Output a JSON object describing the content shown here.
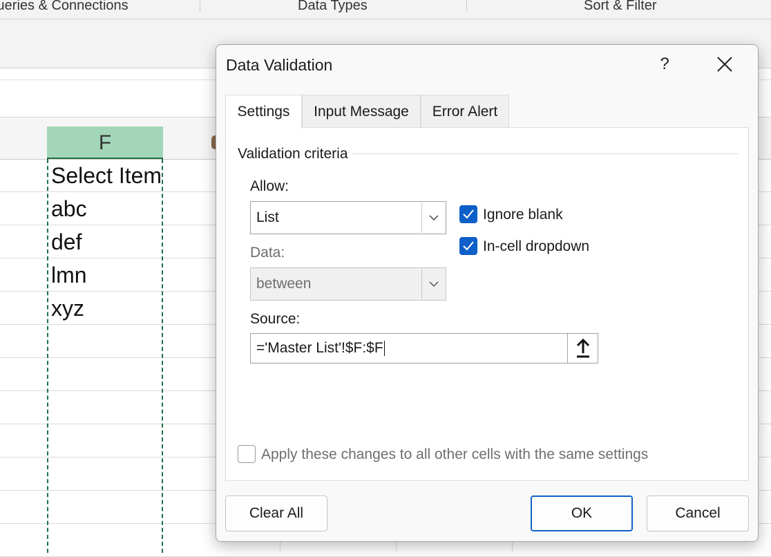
{
  "ribbon": {
    "groups": [
      "Queries & Connections",
      "Data Types",
      "Sort & Filter"
    ]
  },
  "sheet": {
    "selected_column": "F",
    "cells": [
      "Select Item",
      "abc",
      "def",
      "lmn",
      "xyz"
    ]
  },
  "dialog": {
    "title": "Data Validation",
    "help_label": "?",
    "tabs": [
      {
        "label": "Settings",
        "active": true
      },
      {
        "label": "Input Message",
        "active": false
      },
      {
        "label": "Error Alert",
        "active": false
      }
    ],
    "group_label": "Validation criteria",
    "allow": {
      "label": "Allow:",
      "value": "List"
    },
    "data": {
      "label": "Data:",
      "value": "between"
    },
    "source": {
      "label": "Source:",
      "value": "='Master List'!$F:$F"
    },
    "ignore_blank": {
      "label": "Ignore blank",
      "checked": true
    },
    "in_cell_dropdown": {
      "label": "In-cell dropdown",
      "checked": true
    },
    "apply_all": {
      "label": "Apply these changes to all other cells with the same settings",
      "checked": false
    },
    "buttons": {
      "clear_all": "Clear All",
      "ok": "OK",
      "cancel": "Cancel"
    }
  },
  "colors": {
    "accent": "#0f5fc8",
    "selected_header": "#a3d6b8",
    "selection_border": "#1e7145"
  },
  "icons": [
    "close-icon",
    "help-icon",
    "chevron-down-icon",
    "check-icon",
    "collapse-dialog-icon"
  ]
}
